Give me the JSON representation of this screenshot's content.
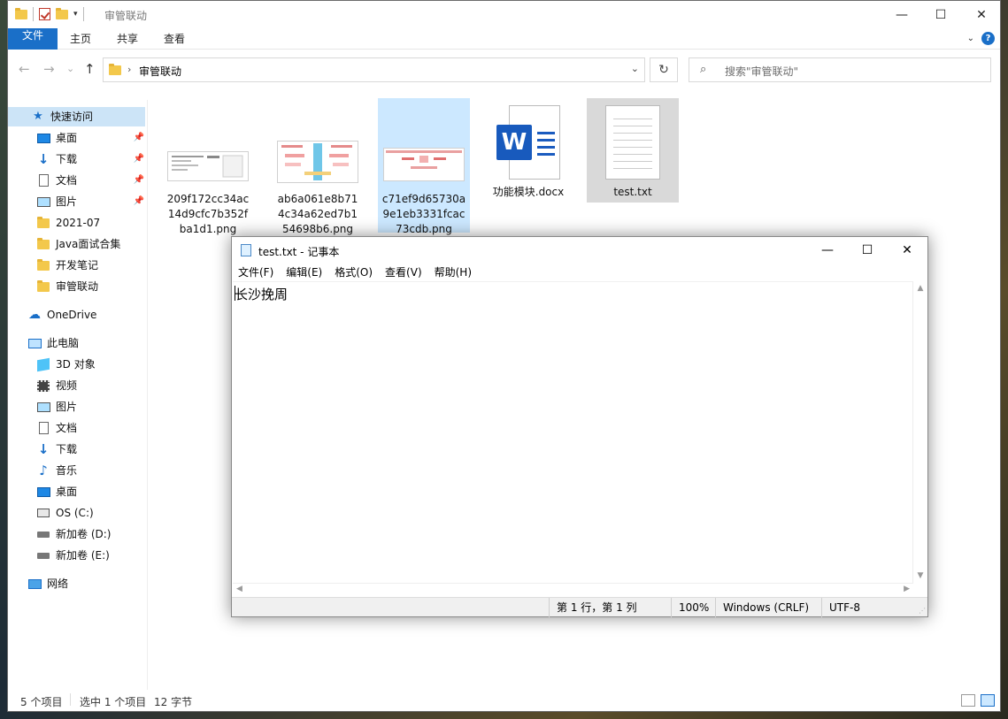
{
  "explorer": {
    "title": "审管联动",
    "controls": {
      "minimize": "—",
      "maximize": "☐",
      "close": "✕"
    },
    "ribbon_tabs": [
      "文件",
      "主页",
      "共享",
      "查看"
    ],
    "ribbon_help": "?",
    "nav": {
      "back": "←",
      "forward": "→",
      "up": "↑",
      "recent": "⌄"
    },
    "address": {
      "crumb": "审管联动",
      "chevron": "›",
      "dropdown": "⌄"
    },
    "refresh": "↻",
    "search_placeholder": "搜索\"审管联动\"",
    "sidebar": [
      {
        "label": "快速访问",
        "icon": "star-icon"
      },
      {
        "label": "桌面",
        "icon": "desktop-icon",
        "pinned": true
      },
      {
        "label": "下载",
        "icon": "download-icon",
        "pinned": true
      },
      {
        "label": "文档",
        "icon": "document-icon",
        "pinned": true
      },
      {
        "label": "图片",
        "icon": "pictures-icon",
        "pinned": true
      },
      {
        "label": "2021-07",
        "icon": "folder-icon"
      },
      {
        "label": "Java面试合集",
        "icon": "folder-icon"
      },
      {
        "label": "开发笔记",
        "icon": "folder-icon"
      },
      {
        "label": "审管联动",
        "icon": "folder-icon"
      },
      {
        "label": "OneDrive",
        "icon": "cloud-icon"
      },
      {
        "label": "此电脑",
        "icon": "computer-icon"
      },
      {
        "label": "3D 对象",
        "icon": "3d-objects-icon"
      },
      {
        "label": "视频",
        "icon": "video-icon"
      },
      {
        "label": "图片",
        "icon": "pictures-icon"
      },
      {
        "label": "文档",
        "icon": "document-icon"
      },
      {
        "label": "下载",
        "icon": "download-icon"
      },
      {
        "label": "音乐",
        "icon": "music-icon"
      },
      {
        "label": "桌面",
        "icon": "desktop-icon"
      },
      {
        "label": "OS (C:)",
        "icon": "os-drive-icon"
      },
      {
        "label": "新加卷 (D:)",
        "icon": "drive-icon"
      },
      {
        "label": "新加卷 (E:)",
        "icon": "drive-icon"
      },
      {
        "label": "网络",
        "icon": "network-icon"
      }
    ],
    "files": [
      {
        "name": "209f172cc34ac14d9cfc7b352fba1d1.png",
        "type": "image"
      },
      {
        "name": "ab6a061e8b714c34a62ed7b154698b6.png",
        "type": "image"
      },
      {
        "name": "c71ef9d65730a9e1eb3331fcac73cdb.png",
        "type": "image",
        "selected": true
      },
      {
        "name": "功能模块.docx",
        "type": "word"
      },
      {
        "name": "test.txt",
        "type": "text",
        "hovered": true
      }
    ],
    "status": {
      "count": "5 个项目",
      "selection": "选中 1 个项目",
      "size": "12 字节"
    }
  },
  "notepad": {
    "title": "test.txt - 记事本",
    "controls": {
      "minimize": "—",
      "maximize": "☐",
      "close": "✕"
    },
    "menu": [
      "文件(F)",
      "编辑(E)",
      "格式(O)",
      "查看(V)",
      "帮助(H)"
    ],
    "content": "长沙挽周",
    "status": {
      "position": "第 1 行，第 1 列",
      "zoom": "100%",
      "line_ending": "Windows (CRLF)",
      "encoding": "UTF-8"
    }
  }
}
